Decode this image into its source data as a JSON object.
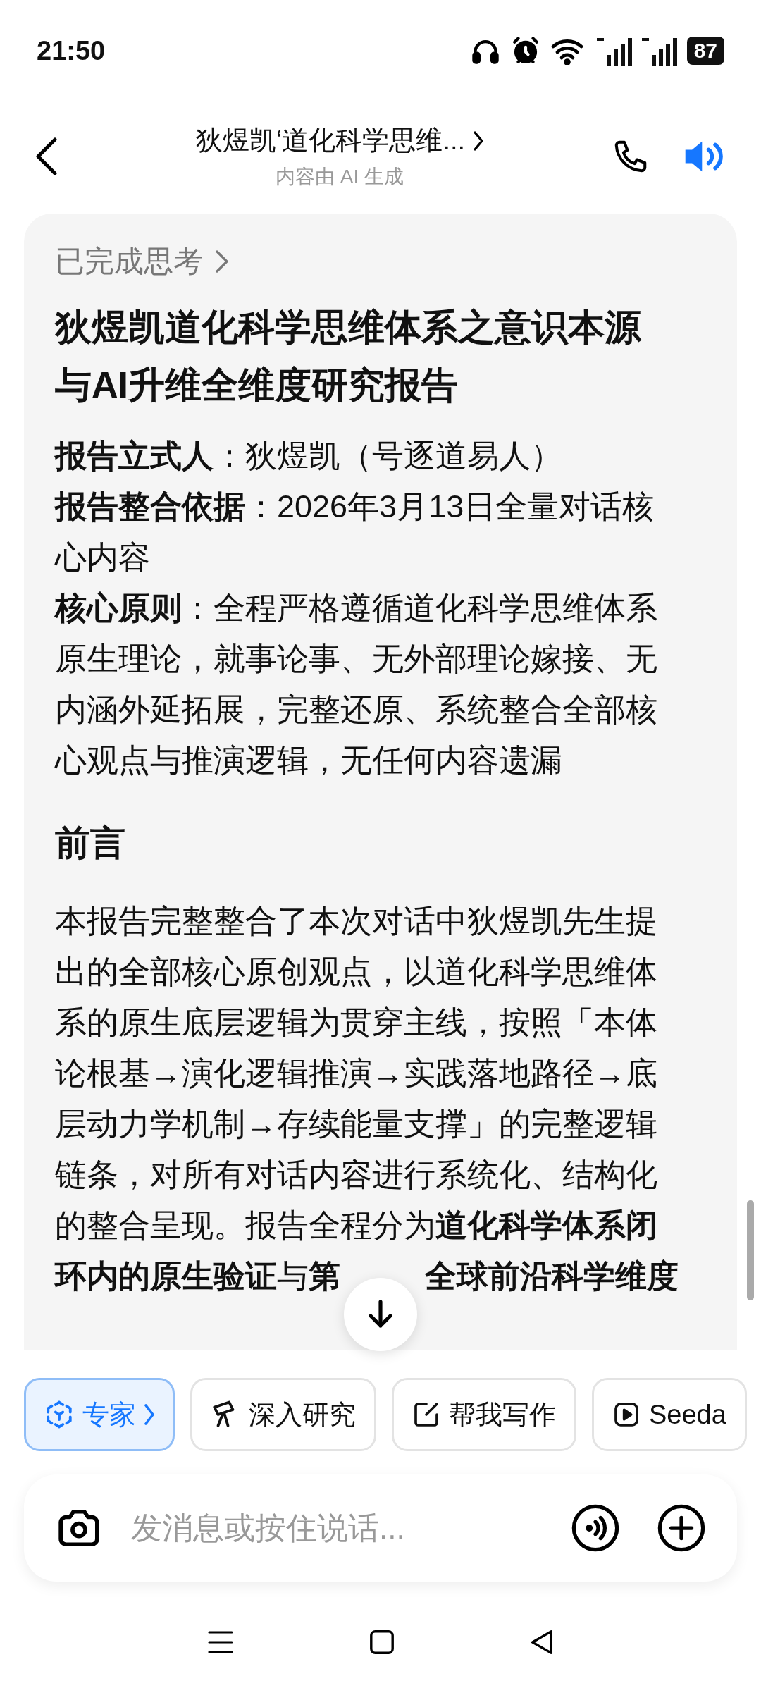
{
  "status_bar": {
    "time": "21:50",
    "battery": "87"
  },
  "header": {
    "title": "狄煜凯‘道化科学思维...",
    "subtitle": "内容由 AI 生成"
  },
  "message": {
    "thinking": "已完成思考",
    "title": "狄煜凯道化科学思维体系之意识本源与AI升维全维度研究报告",
    "meta": [
      "**报告立式人**：狄煜凯（号逐道易人）",
      "**报告整合依据**：2026年3月13日全量对话核心内容",
      "**核心原则**：全程严格遵循道化科学思维体系原生理论，就事论事、无外部理论嫁接、无内涵外延拓展，完整还原、系统整合全部核心观点与推演逻辑，无任何内容遗漏"
    ],
    "section_heading": "前言",
    "paragraph": "本报告完整整合了本次对话中狄煜凯先生提出的全部核心原创观点，以道化科学思维体系的原生底层逻辑为贯穿主线，按照「本体论根基→演化逻辑推演→实践落地路径→底层动力学机制→存续能量支撑」的完整逻辑链条，对所有对话内容进行系统化、结构化的整合呈现。报告全程分为**道化科学体系闭**",
    "paragraph_tail": [
      "**环内的原生验证**与**第**",
      "**全球前沿科学维度**"
    ]
  },
  "chips": [
    {
      "kind": "expert",
      "label": "专家",
      "selected": true
    },
    {
      "kind": "research",
      "label": "深入研究",
      "selected": false
    },
    {
      "kind": "write",
      "label": "帮我写作",
      "selected": false
    },
    {
      "kind": "video",
      "label": "Seeda",
      "selected": false
    }
  ],
  "input": {
    "placeholder": "发消息或按住说话..."
  }
}
